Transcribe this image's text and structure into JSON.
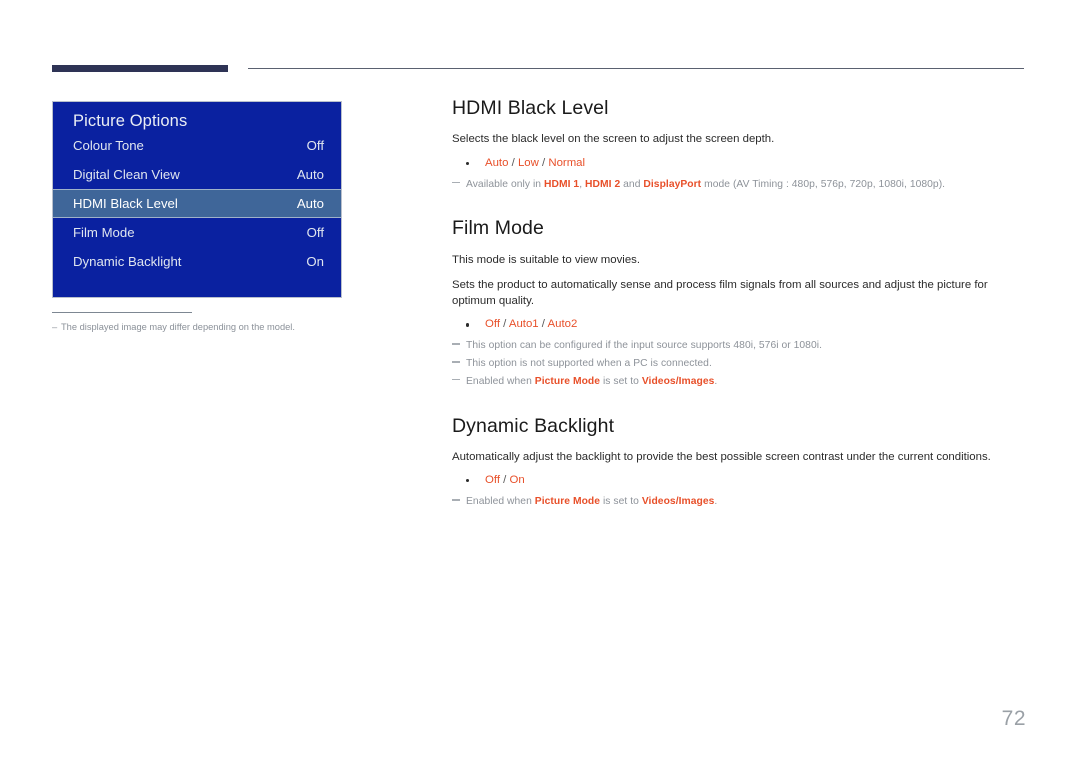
{
  "header": {
    "accent_color": "#2e3355",
    "rule_color": "#5a6170"
  },
  "osd": {
    "title": "Picture Options",
    "panel_color": "#0a21a0",
    "highlight_color": "#3f6699",
    "rows": [
      {
        "label": "Colour Tone",
        "value": "Off",
        "selected": false
      },
      {
        "label": "Digital Clean View",
        "value": "Auto",
        "selected": false
      },
      {
        "label": "HDMI Black Level",
        "value": "Auto",
        "selected": true
      },
      {
        "label": "Film Mode",
        "value": "Off",
        "selected": false
      },
      {
        "label": "Dynamic Backlight",
        "value": "On",
        "selected": false
      }
    ],
    "footnote_dash": "–",
    "footnote": "The displayed image may differ depending on the model."
  },
  "sections": [
    {
      "title": "HDMI Black Level",
      "paragraphs": [
        "Selects the black level on the screen to adjust the screen depth."
      ],
      "options": [
        {
          "text": "Auto",
          "accent": true
        },
        {
          "text": " / ",
          "accent": false
        },
        {
          "text": "Low",
          "accent": true
        },
        {
          "text": " / ",
          "accent": false
        },
        {
          "text": "Normal",
          "accent": true
        }
      ],
      "notes": [
        [
          {
            "text": "Available only in ",
            "accent": false
          },
          {
            "text": "HDMI 1",
            "accent": true
          },
          {
            "text": ", ",
            "accent": false
          },
          {
            "text": "HDMI 2",
            "accent": true
          },
          {
            "text": " and ",
            "accent": false
          },
          {
            "text": "DisplayPort",
            "accent": true
          },
          {
            "text": " mode (AV Timing : 480p, 576p, 720p, 1080i, 1080p).",
            "accent": false
          }
        ]
      ]
    },
    {
      "title": "Film Mode",
      "paragraphs": [
        "This mode is suitable to view movies.",
        "Sets the product to automatically sense and process film signals from all sources and adjust the picture for optimum quality."
      ],
      "options": [
        {
          "text": "Off",
          "accent": true
        },
        {
          "text": " / ",
          "accent": false
        },
        {
          "text": "Auto1",
          "accent": true
        },
        {
          "text": " / ",
          "accent": false
        },
        {
          "text": "Auto2",
          "accent": true
        }
      ],
      "notes": [
        [
          {
            "text": "This option can be configured if the input source supports 480i, 576i or 1080i.",
            "accent": false
          }
        ],
        [
          {
            "text": "This option is not supported when a PC is connected.",
            "accent": false
          }
        ],
        [
          {
            "text": "Enabled when ",
            "accent": false
          },
          {
            "text": "Picture Mode",
            "accent": true
          },
          {
            "text": " is set to ",
            "accent": false
          },
          {
            "text": "Videos/Images",
            "accent": true
          },
          {
            "text": ".",
            "accent": false
          }
        ]
      ]
    },
    {
      "title": "Dynamic Backlight",
      "paragraphs": [
        "Automatically adjust the backlight to provide the best possible screen contrast under the current conditions."
      ],
      "options": [
        {
          "text": "Off",
          "accent": true
        },
        {
          "text": " / ",
          "accent": false
        },
        {
          "text": "On",
          "accent": true
        }
      ],
      "notes": [
        [
          {
            "text": "Enabled when ",
            "accent": false
          },
          {
            "text": "Picture Mode",
            "accent": true
          },
          {
            "text": " is set to ",
            "accent": false
          },
          {
            "text": "Videos/Images",
            "accent": true
          },
          {
            "text": ".",
            "accent": false
          }
        ]
      ]
    }
  ],
  "footer": {
    "page_number": "72"
  },
  "colors": {
    "accent_orange": "#e8502a",
    "note_gray": "#8d9299",
    "body_text": "#2b2b2b"
  }
}
